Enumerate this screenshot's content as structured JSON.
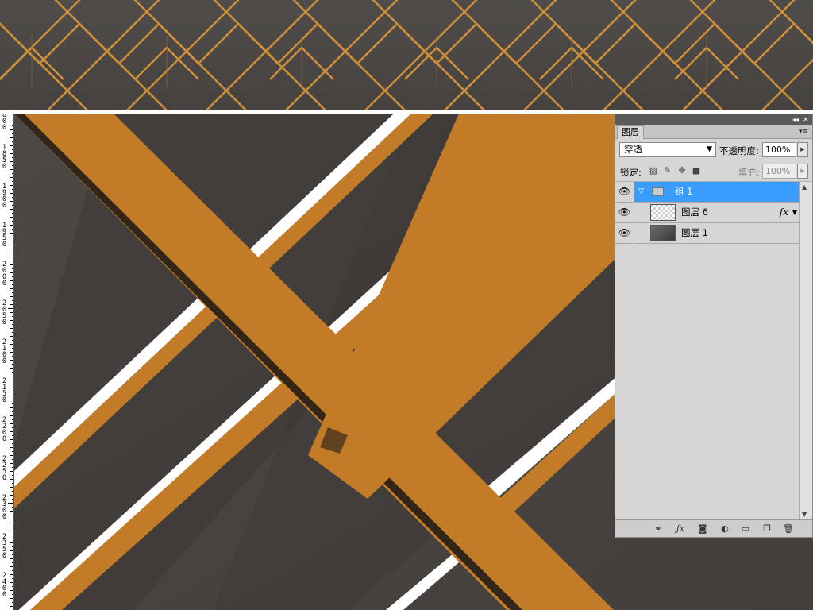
{
  "layers_panel": {
    "tab_label": "图层",
    "panel_menu_icon": "panel-menu-icon",
    "collapse_icon": "double-arrow-icon",
    "close_icon": "close-icon",
    "blend_mode": "穿透",
    "opacity_label": "不透明度:",
    "opacity_value": "100%",
    "lock_label": "锁定:",
    "fill_label": "填充:",
    "fill_value": "100%",
    "layers": [
      {
        "name": "组 1",
        "kind": "group",
        "visible": true,
        "selected": true,
        "expanded": true
      },
      {
        "name": "图层 6",
        "kind": "layer",
        "visible": true,
        "selected": false,
        "has_effects": true,
        "effects_badge": "fx"
      },
      {
        "name": "图层 1",
        "kind": "layer",
        "visible": true,
        "selected": false
      }
    ],
    "bottom_icons": [
      "link-layers-icon",
      "add-style-icon",
      "add-mask-icon",
      "adjustment-layer-icon",
      "new-group-icon",
      "new-layer-icon",
      "trash-icon"
    ]
  },
  "ruler": {
    "labels": [
      "1800",
      "1850",
      "1900",
      "1950",
      "2000",
      "2050",
      "2100",
      "2150",
      "2200",
      "2250",
      "2300",
      "2350",
      "2400"
    ]
  },
  "colors": {
    "accent_orange": "#c27c27",
    "background_gray": "#4a4643",
    "selection_blue": "#3b9cff",
    "gold_line": "#cf8f3a"
  }
}
